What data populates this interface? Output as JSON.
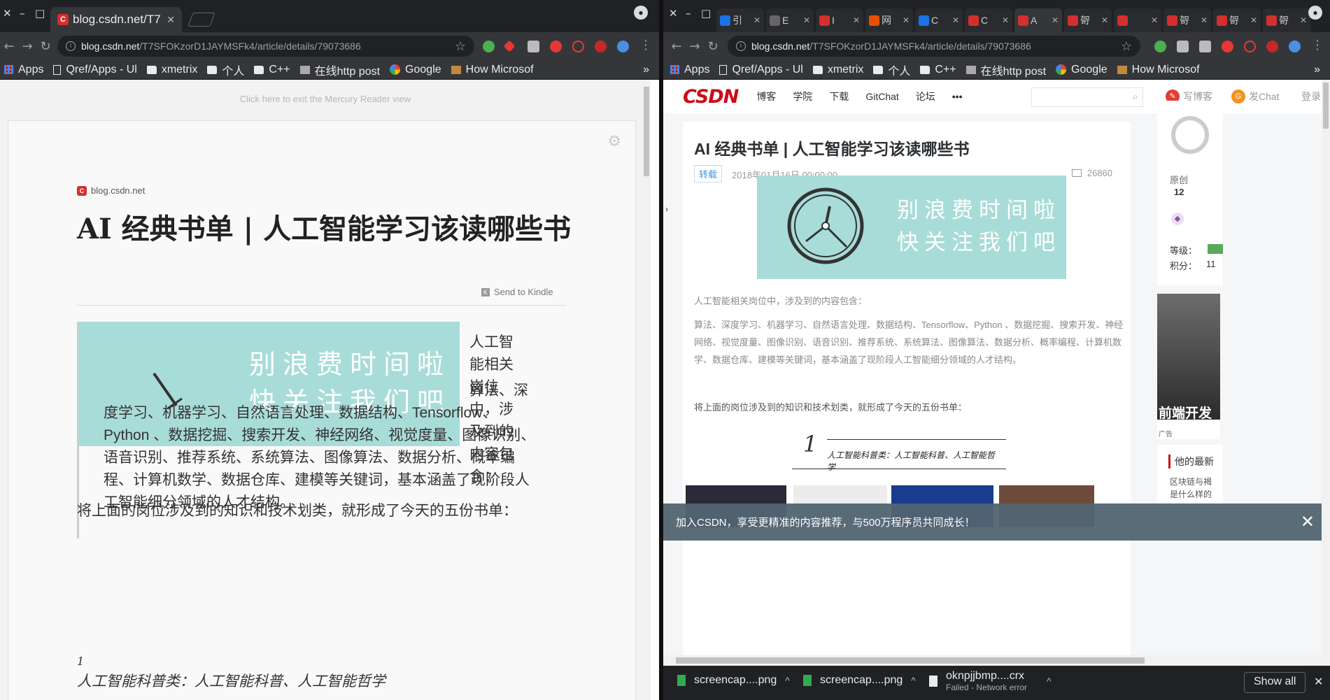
{
  "left": {
    "tab_title": "blog.csdn.net/T7",
    "url_host": "blog.csdn.net",
    "url_path": "/T7SFOKzorD1JAYMSFk4/article/details/79073686",
    "bookmarks": [
      "Apps",
      "Qref/Apps - Ul",
      "xmetrix",
      "个人",
      "C++",
      "在线http post",
      "Google",
      "How Microsof"
    ],
    "reader": {
      "exit_link": "Click here to exit the Mercury Reader view",
      "site": "blog.csdn.net",
      "title": "AI 经典书单 | 人工智能学习该读哪些书",
      "send_to_kindle": "Send to Kindle",
      "banner_line1": "别浪费时间啦",
      "banner_line2": "快关注我们吧",
      "float_text": "人工智能相关岗位中，涉及到的内容包含：",
      "para1_first": "算法、深",
      "para1_rest": "度学习、机器学习、自然语言处理、数据结构、Tensorflow、Python 、数据挖掘、搜索开发、神经网络、视觉度量、图像识别、语音识别、推荐系统、系统算法、图像算法、数据分析、概率编程、计算机数学、数据仓库、建模等关键词，基本涵盖了现阶段人工智能细分领域的人才结构。",
      "para2": "将上面的岗位涉及到的知识和技术划类，就形成了今天的五份书单：",
      "list_num": "1",
      "list_head": "人工智能科普类：人工智能科普、人工智能哲学"
    }
  },
  "right": {
    "tabs": [
      "引",
      "E",
      "I",
      "网",
      "C",
      "C",
      "A",
      "哿",
      "",
      "哿",
      "哿",
      "哿"
    ],
    "url_host": "blog.csdn.net",
    "url_path": "/T7SFOKzorD1JAYMSFk4/article/details/79073686",
    "bookmarks": [
      "Apps",
      "Qref/Apps - Ul",
      "xmetrix",
      "个人",
      "C++",
      "在线http post",
      "Google",
      "How Microsof"
    ],
    "nav": {
      "logo": "CSDN",
      "items": [
        "博客",
        "学院",
        "下载",
        "GitChat",
        "论坛",
        "•••"
      ],
      "write_blog": "写博客",
      "gitchat": "发Chat",
      "login": "登录"
    },
    "article": {
      "title": "AI 经典书单 | 人工智能学习该读哪些书",
      "tag": "转载",
      "date": "2018年01月16日 00:00:00",
      "views": "26860",
      "banner_line1": "别浪费时间啦",
      "banner_line2": "快关注我们吧",
      "intro": "人工智能相关岗位中，涉及到的内容包含：",
      "keywords": "算法、深度学习、机器学习、自然语言处理、数据结构、Tensorflow、Python 、数据挖掘、搜索开发、神经网络、视觉度量、图像识别、语音识别、推荐系统、系统算法、图像算法、数据分析、概率编程、计算机数学、数据仓库、建模等关键词，基本涵盖了现阶段人工智能细分领域的人才结构。",
      "summary": "将上面的岗位涉及到的知识和技术划类，就形成了今天的五份书单：",
      "list_num": "1",
      "list_head": "人工智能科普类：人工智能科普、人工智能哲学"
    },
    "sidebar": {
      "original_label": "原创",
      "original_count": "12",
      "level_label": "等级：",
      "points_label": "积分：",
      "points_value": "11",
      "ad_text": "前端开发",
      "ad_label": "广告",
      "latest_label": "他的最新",
      "latest1": "区块链与褐",
      "latest2": "是什么样的"
    },
    "toast": {
      "text": "加入CSDN，享受更精准的内容推荐，与500万程序员共同成长！",
      "close": "✕"
    },
    "downloads": [
      {
        "name": "screencap....png",
        "status": ""
      },
      {
        "name": "screencap....png",
        "status": ""
      },
      {
        "name": "oknpjjbmp....crx",
        "status": "Failed - Network error"
      }
    ],
    "show_all": "Show all"
  }
}
